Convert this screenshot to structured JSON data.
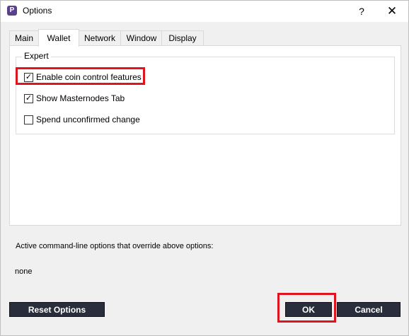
{
  "window": {
    "title": "Options",
    "help_glyph": "?",
    "close_glyph": "✕",
    "icon": "app-logo-icon"
  },
  "tabs": [
    {
      "label": "Main",
      "active": false
    },
    {
      "label": "Wallet",
      "active": true
    },
    {
      "label": "Network",
      "active": false
    },
    {
      "label": "Window",
      "active": false
    },
    {
      "label": "Display",
      "active": false
    }
  ],
  "expert": {
    "title": "Expert",
    "options": [
      {
        "label": "Enable coin control features",
        "checked": true
      },
      {
        "label": "Show Masternodes Tab",
        "checked": true
      },
      {
        "label": "Spend unconfirmed change",
        "checked": false
      }
    ]
  },
  "info": {
    "override_text": "Active command-line options that override above options:",
    "override_value": "none"
  },
  "buttons": {
    "reset": "Reset Options",
    "ok": "OK",
    "cancel": "Cancel"
  },
  "colors": {
    "highlight": "#e0141e",
    "button_bg": "#2a2d3c",
    "app_icon": "#5a3f8c"
  }
}
